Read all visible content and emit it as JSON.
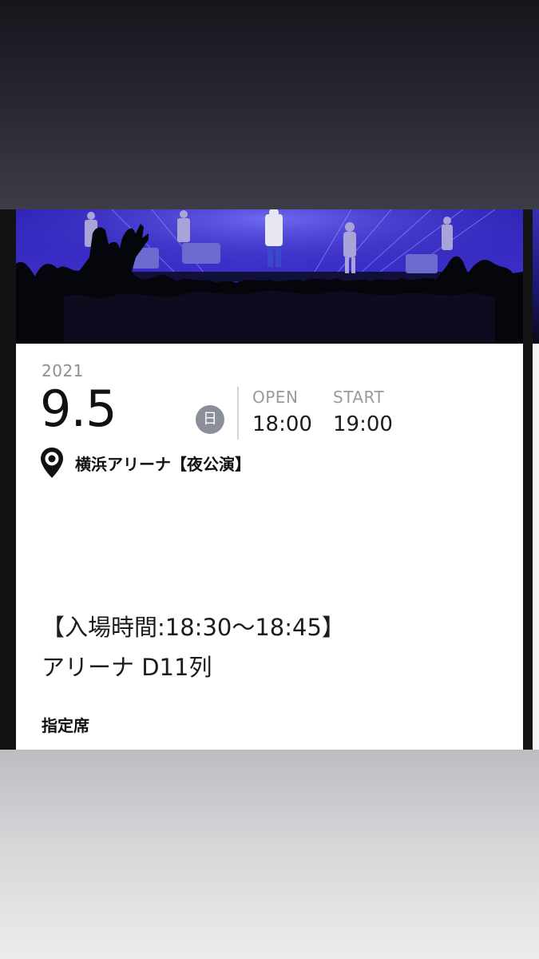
{
  "colors": {
    "top_gradient": "#26262f",
    "bottom_gradient": "#d6d6d9",
    "card_background": "#ffffff",
    "weekday_badge": "#8a8f99",
    "muted_text": "#8e8e93",
    "stage_light": "#3b2ec7"
  },
  "ticket": {
    "photo": {
      "icon": "concert-stage-photo"
    },
    "year": "2021",
    "date": "9.5",
    "weekday": "日",
    "open": {
      "label": "OPEN",
      "time": "18:00"
    },
    "start": {
      "label": "START",
      "time": "19:00"
    },
    "venue": {
      "icon": "location-pin-icon",
      "name": "横浜アリーナ【夜公演】"
    },
    "entry_time": "【入場時間:18:30〜18:45】",
    "seat": "アリーナ D11列",
    "seat_type": "指定席"
  }
}
